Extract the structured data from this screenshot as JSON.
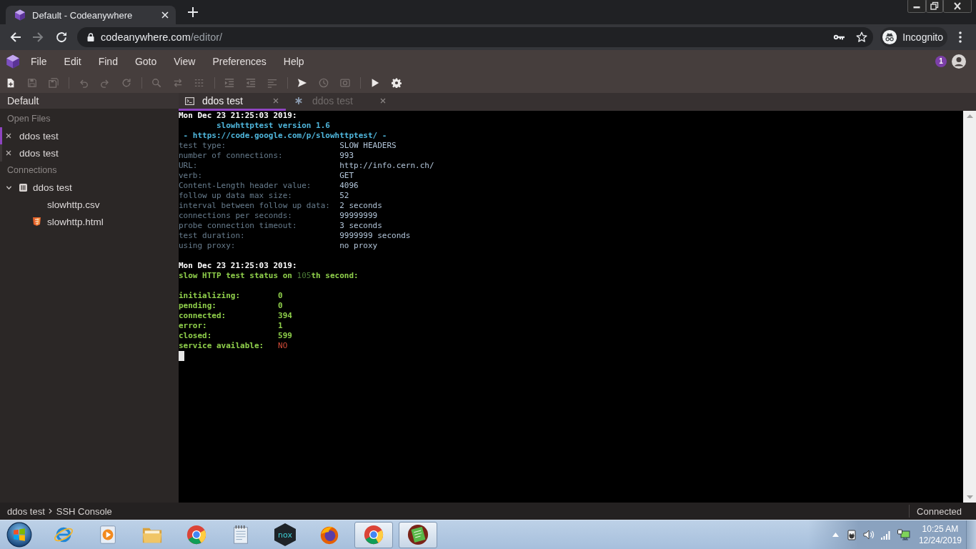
{
  "browser": {
    "tabs": [
      {
        "title": "Default - Codeanywhere",
        "selected": true
      }
    ],
    "back": {
      "disabled": false
    },
    "forward": {
      "disabled": true
    },
    "address": {
      "host": "codeanywhere.com",
      "path": "/editor/"
    },
    "profile": "Incognito"
  },
  "menu": [
    "File",
    "Edit",
    "Find",
    "Goto",
    "View",
    "Preferences",
    "Help"
  ],
  "notifications": "1",
  "toolbar": [
    {
      "buttons": [
        {
          "disabled": false
        },
        {
          "disabled": true
        },
        {
          "disabled": true
        }
      ]
    },
    {
      "buttons": [
        {
          "disabled": true
        },
        {
          "disabled": true
        },
        {
          "disabled": true
        }
      ]
    },
    {
      "buttons": [
        {
          "disabled": true
        },
        {
          "disabled": true
        },
        {
          "disabled": true
        }
      ]
    },
    {
      "buttons": [
        {
          "disabled": true
        },
        {
          "disabled": true
        },
        {
          "disabled": true
        }
      ]
    },
    {
      "buttons": [
        {
          "disabled": false
        },
        {
          "disabled": true
        },
        {
          "disabled": true
        }
      ]
    },
    {
      "buttons": [
        {
          "disabled": false
        },
        {
          "disabled": false
        }
      ]
    }
  ],
  "sidebar": {
    "title": "Default",
    "open_files": {
      "title": "Open Files",
      "items": [
        {
          "label": "ddos test",
          "selected": true
        },
        {
          "label": "ddos test",
          "selected": false
        }
      ]
    },
    "connections": {
      "title": "Connections",
      "items": [
        {
          "label": "ddos test",
          "expanded": true,
          "children": [
            {
              "label": "slowhttp.csv",
              "kind": "csv"
            },
            {
              "label": "slowhttp.html",
              "kind": "html"
            }
          ]
        }
      ]
    }
  },
  "editor_tabs": [
    {
      "label": "ddos test",
      "kind": "terminal",
      "selected": true
    },
    {
      "label": "ddos test",
      "kind": "editor",
      "selected": false
    }
  ],
  "terminal": {
    "header": {
      "timestamp": "Mon Dec 23 21:25:03 2019:",
      "title": "slowhttptest version 1.6",
      "link": "- https://code.google.com/p/slowhttptest/ -"
    },
    "settings": [
      {
        "label": "test type:",
        "value": "SLOW HEADERS"
      },
      {
        "label": "number of connections:",
        "value": "993"
      },
      {
        "label": "URL:",
        "value": "http://info.cern.ch/"
      },
      {
        "label": "verb:",
        "value": "GET"
      },
      {
        "label": "Content-Length header value:",
        "value": "4096"
      },
      {
        "label": "follow up data max size:",
        "value": "52"
      },
      {
        "label": "interval between follow up data:",
        "value": "2 seconds"
      },
      {
        "label": "connections per seconds:",
        "value": "99999999"
      },
      {
        "label": "probe connection timeout:",
        "value": "3 seconds"
      },
      {
        "label": "test duration:",
        "value": "9999999 seconds"
      },
      {
        "label": "using proxy:",
        "value": "no proxy"
      }
    ],
    "status": {
      "timestamp": "Mon Dec 23 21:25:03 2019:",
      "heading": {
        "before": "slow HTTP test status on",
        "second": "105",
        "after": "th second:"
      },
      "counters": [
        {
          "label": "initializing:",
          "value": "0",
          "alert": false
        },
        {
          "label": "pending:",
          "value": "0",
          "alert": false
        },
        {
          "label": "connected:",
          "value": "394",
          "alert": false
        },
        {
          "label": "error:",
          "value": "1",
          "alert": false
        },
        {
          "label": "closed:",
          "value": "599",
          "alert": false
        },
        {
          "label": "service available:",
          "value": "NO",
          "alert": true
        }
      ]
    }
  },
  "status_bar": {
    "breadcrumb": [
      "ddos test",
      "SSH Console"
    ],
    "connection": "Connected"
  },
  "taskbar": {
    "apps": [
      {
        "selected": false
      },
      {
        "selected": false
      },
      {
        "selected": false
      },
      {
        "selected": false
      },
      {
        "selected": false
      },
      {
        "selected": false,
        "label": "nox"
      },
      {
        "selected": false
      },
      {
        "selected": true
      },
      {
        "selected": true
      }
    ],
    "clock": {
      "time": "10:25 AM",
      "date": "12/24/2019"
    }
  }
}
